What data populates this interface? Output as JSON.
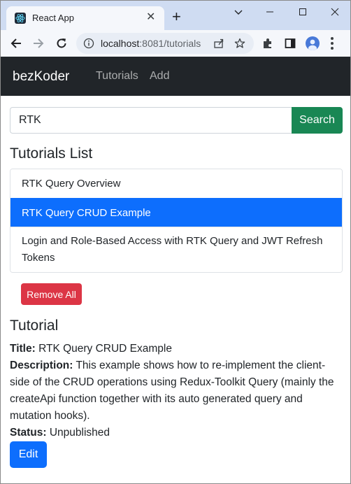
{
  "browser": {
    "tab_title": "React App",
    "url_host": "localhost",
    "url_path": ":8081/tutorials"
  },
  "navbar": {
    "brand": "bezKoder",
    "links": [
      "Tutorials",
      "Add"
    ]
  },
  "search": {
    "value": "RTK",
    "button_label": "Search"
  },
  "tutorials_list": {
    "heading": "Tutorials List",
    "items": [
      "RTK Query Overview",
      "RTK Query CRUD Example",
      "Login and Role-Based Access with RTK Query and JWT Refresh Tokens"
    ],
    "active_index": 1,
    "remove_all_label": "Remove All"
  },
  "tutorial": {
    "heading": "Tutorial",
    "title_label": "Title:",
    "title": "RTK Query CRUD Example",
    "description_label": "Description:",
    "description": "This example shows how to re-implement the client-side of the CRUD operations using Redux-Toolkit Query (mainly the createApi function together with its auto generated query and mutation hooks).",
    "status_label": "Status:",
    "status": "Unpublished",
    "edit_label": "Edit"
  },
  "colors": {
    "navbar_bg": "#212529",
    "search_button": "#198754",
    "active_item": "#0d6efd",
    "remove_button": "#dc3545",
    "edit_button": "#0d6efd"
  }
}
